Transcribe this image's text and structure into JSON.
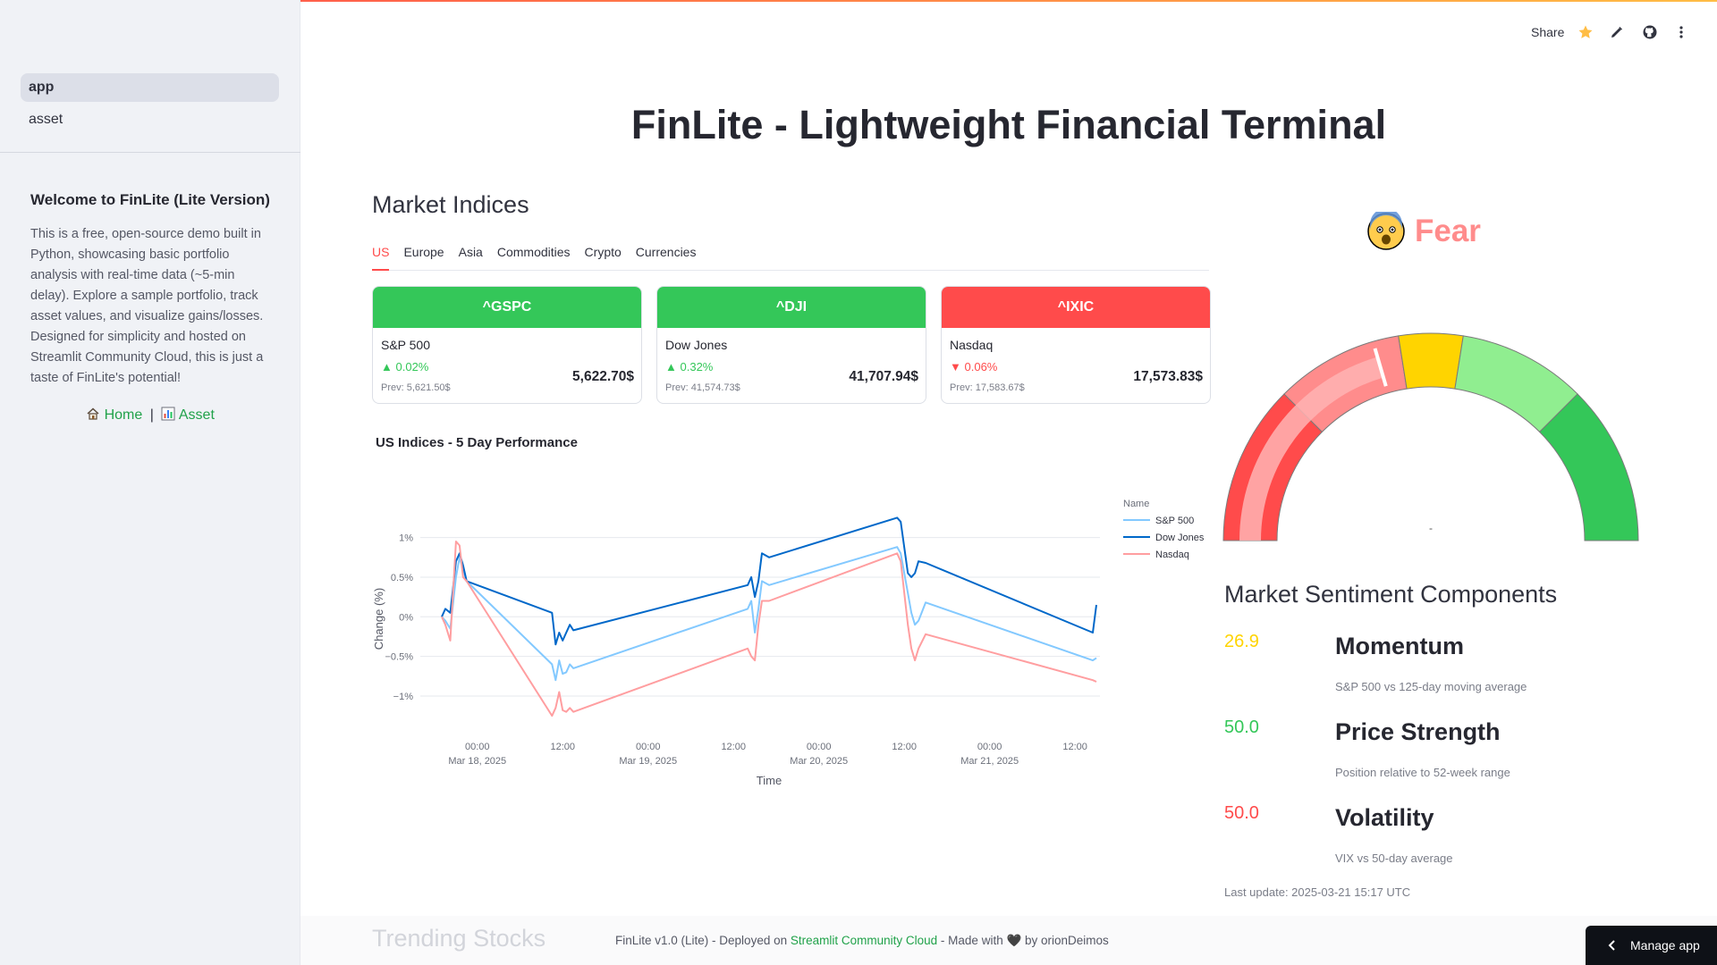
{
  "sidebar": {
    "nav": [
      {
        "label": "app",
        "active": true
      },
      {
        "label": "asset",
        "active": false
      }
    ],
    "welcome_title": "Welcome to FinLite (Lite Version)",
    "welcome_text": "This is a free, open-source demo built in Python, showcasing basic portfolio analysis with real-time data (~5-min delay). Explore a sample portfolio, track asset values, and visualize gains/losses. Designed for simplicity and hosted on Streamlit Community Cloud, this is just a taste of FinLite's potential!",
    "links": {
      "home": "Home",
      "separator": "|",
      "asset": "Asset"
    }
  },
  "toolbar": {
    "share_label": "Share",
    "icons": [
      "star-icon",
      "pencil-icon",
      "github-icon",
      "more-vertical-icon"
    ],
    "star_color": "#ffbd45"
  },
  "main": {
    "title": "FinLite - Lightweight Financial Terminal",
    "market_indices_title": "Market Indices",
    "tabs": [
      "US",
      "Europe",
      "Asia",
      "Commodities",
      "Crypto",
      "Currencies"
    ],
    "active_tab": "US",
    "cards": [
      {
        "symbol": "^GSPC",
        "name": "S&P 500",
        "arrow": "▲",
        "change": "0.02%",
        "prev": "Prev: 5,621.50$",
        "price": "5,622.70$",
        "color": "#34c759"
      },
      {
        "symbol": "^DJI",
        "name": "Dow Jones",
        "arrow": "▲",
        "change": "0.32%",
        "prev": "Prev: 41,574.73$",
        "price": "41,707.94$",
        "color": "#34c759"
      },
      {
        "symbol": "^IXIC",
        "name": "Nasdaq",
        "arrow": "▼",
        "change": "0.06%",
        "prev": "Prev: 17,583.67$",
        "price": "17,573.83$",
        "color": "#ff4b4b"
      }
    ],
    "chart_title": "US Indices - 5 Day Performance"
  },
  "chart_data": {
    "type": "line",
    "title": "US Indices - 5 Day Performance",
    "xlabel": "Time",
    "ylabel": "Change (%)",
    "ylim": [
      -1.35,
      1.3
    ],
    "yticks": [
      {
        "v": 1,
        "label": "1%"
      },
      {
        "v": 0.5,
        "label": "0.5%"
      },
      {
        "v": 0,
        "label": "0%"
      },
      {
        "v": -0.5,
        "label": "−0.5%"
      },
      {
        "v": -1,
        "label": "−1%"
      }
    ],
    "xticks": [
      {
        "t": 0,
        "time": "00:00",
        "date": "Mar 18, 2025"
      },
      {
        "t": 12,
        "time": "12:00",
        "date": ""
      },
      {
        "t": 24,
        "time": "00:00",
        "date": "Mar 19, 2025"
      },
      {
        "t": 36,
        "time": "12:00",
        "date": ""
      },
      {
        "t": 48,
        "time": "00:00",
        "date": "Mar 20, 2025"
      },
      {
        "t": 60,
        "time": "12:00",
        "date": ""
      },
      {
        "t": 72,
        "time": "00:00",
        "date": "Mar 21, 2025"
      },
      {
        "t": 84,
        "time": "12:00",
        "date": ""
      }
    ],
    "xlim": [
      -5.5,
      87.5
    ],
    "legend_title": "Name",
    "legend_position": "right",
    "series": [
      {
        "name": "S&P 500",
        "color": "#83c9ff",
        "points": [
          [
            -5,
            0
          ],
          [
            -4.5,
            -0.05
          ],
          [
            -3.8,
            -0.15
          ],
          [
            -3,
            0.5
          ],
          [
            -2.5,
            0.75
          ],
          [
            -2,
            0.6
          ],
          [
            -1.5,
            0.45
          ],
          [
            10.5,
            -0.6
          ],
          [
            11,
            -0.8
          ],
          [
            11.5,
            -0.55
          ],
          [
            12,
            -0.72
          ],
          [
            12.5,
            -0.7
          ],
          [
            13,
            -0.6
          ],
          [
            13.5,
            -0.65
          ],
          [
            38,
            0.1
          ],
          [
            38.5,
            0.2
          ],
          [
            39,
            -0.2
          ],
          [
            39.5,
            0.1
          ],
          [
            40,
            0.45
          ],
          [
            41,
            0.4
          ],
          [
            59,
            0.88
          ],
          [
            59.5,
            0.8
          ],
          [
            60.5,
            0.3
          ],
          [
            61,
            0.05
          ],
          [
            61.5,
            -0.1
          ],
          [
            62,
            -0.05
          ],
          [
            63,
            0.18
          ],
          [
            86.5,
            -0.55
          ],
          [
            87,
            -0.52
          ]
        ]
      },
      {
        "name": "Dow Jones",
        "color": "#0068c9",
        "points": [
          [
            -5,
            0
          ],
          [
            -4.5,
            0.1
          ],
          [
            -3.8,
            0.05
          ],
          [
            -3,
            0.7
          ],
          [
            -2.5,
            0.8
          ],
          [
            -2,
            0.65
          ],
          [
            -1.5,
            0.45
          ],
          [
            10.5,
            0.05
          ],
          [
            11,
            -0.35
          ],
          [
            11.5,
            -0.2
          ],
          [
            12,
            -0.3
          ],
          [
            12.5,
            -0.2
          ],
          [
            13,
            -0.1
          ],
          [
            13.5,
            -0.17
          ],
          [
            38,
            0.4
          ],
          [
            38.5,
            0.5
          ],
          [
            39,
            0.25
          ],
          [
            39.5,
            0.45
          ],
          [
            40,
            0.8
          ],
          [
            41,
            0.75
          ],
          [
            59,
            1.25
          ],
          [
            59.5,
            1.2
          ],
          [
            60.5,
            0.55
          ],
          [
            61,
            0.5
          ],
          [
            61.5,
            0.55
          ],
          [
            62,
            0.7
          ],
          [
            63,
            0.68
          ],
          [
            86.5,
            -0.2
          ],
          [
            87,
            0.15
          ]
        ]
      },
      {
        "name": "Nasdaq",
        "color": "#ff9ea0",
        "points": [
          [
            -5,
            0
          ],
          [
            -4.5,
            -0.1
          ],
          [
            -3.8,
            -0.3
          ],
          [
            -3,
            0.95
          ],
          [
            -2.5,
            0.9
          ],
          [
            -2,
            0.5
          ],
          [
            -1.5,
            0.45
          ],
          [
            10.5,
            -1.25
          ],
          [
            11,
            -1.15
          ],
          [
            11.5,
            -0.95
          ],
          [
            12,
            -1.18
          ],
          [
            12.5,
            -1.2
          ],
          [
            13,
            -1.15
          ],
          [
            13.5,
            -1.2
          ],
          [
            38,
            -0.4
          ],
          [
            38.5,
            -0.5
          ],
          [
            39,
            -0.55
          ],
          [
            39.5,
            -0.1
          ],
          [
            40,
            0.2
          ],
          [
            41,
            0.2
          ],
          [
            59,
            0.8
          ],
          [
            59.5,
            0.7
          ],
          [
            60.5,
            -0.1
          ],
          [
            61,
            -0.4
          ],
          [
            61.5,
            -0.55
          ],
          [
            62,
            -0.4
          ],
          [
            63,
            -0.22
          ],
          [
            86.5,
            -0.8
          ],
          [
            87,
            -0.82
          ]
        ]
      }
    ]
  },
  "sentiment": {
    "label": "Fear",
    "color": "#ff8c8c",
    "gauge_value": 41,
    "gauge_center_marker": "-",
    "gauge_bands": [
      {
        "from": 0,
        "to": 25,
        "color": "#ff4b4b"
      },
      {
        "from": 25,
        "to": 45,
        "color": "#ff8c8c"
      },
      {
        "from": 45,
        "to": 55,
        "color": "#ffd400"
      },
      {
        "from": 55,
        "to": 75,
        "color": "#90ee90"
      },
      {
        "from": 75,
        "to": 100,
        "color": "#34c759"
      }
    ],
    "components_title": "Market Sentiment Components",
    "components": [
      {
        "value": "26.9",
        "name": "Momentum",
        "desc": "S&P 500 vs 125-day moving average",
        "color": "#ffd400"
      },
      {
        "value": "50.0",
        "name": "Price Strength",
        "desc": "Position relative to 52-week range",
        "color": "#34c759"
      },
      {
        "value": "50.0",
        "name": "Volatility",
        "desc": "VIX vs 50-day average",
        "color": "#ff4b4b"
      }
    ],
    "last_update": "Last update: 2025-03-21 15:17 UTC"
  },
  "footer": {
    "trending_title": "Trending Stocks",
    "prefix": "FinLite v1.0 (Lite) - Deployed on ",
    "link": "Streamlit Community Cloud",
    "suffix": " - Made with ",
    "heart": "🖤",
    "by": " by orionDeimos",
    "manage_app": "Manage app"
  }
}
